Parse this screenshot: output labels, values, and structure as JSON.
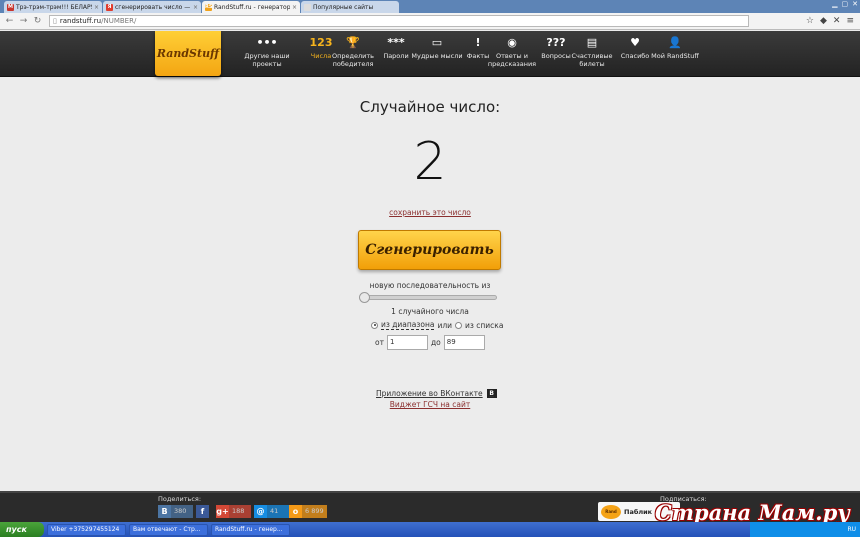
{
  "browser": {
    "tabs": [
      {
        "label": "Трэ-трэм-трэм!!! БЕЛАРУС",
        "fav": "M",
        "fav_color": "#c8342d",
        "active": false
      },
      {
        "label": "сгенерировать число — Ян",
        "fav": "Я",
        "fav_color": "#e03b2c",
        "active": false
      },
      {
        "label": "RandStuff.ru - генератор сл",
        "fav": "RS",
        "fav_color": "#f0a21b",
        "active": true
      },
      {
        "label": "Популярные сайты",
        "fav": "",
        "fav_color": "#dddddd",
        "active": false
      }
    ],
    "url_host": "randstuff.ru",
    "url_path": "/NUMBER/"
  },
  "site": {
    "logo": "RandStuff",
    "nav": [
      {
        "icon": "•••",
        "label": "Другие наши проекты",
        "active": false
      },
      {
        "icon": "123",
        "label": "Числа",
        "active": true
      },
      {
        "icon": "🏆",
        "label": "Определить победителя",
        "active": false
      },
      {
        "icon": "***",
        "label": "Пароли",
        "active": false
      },
      {
        "icon": "▭",
        "label": "Мудрые мысли",
        "active": false
      },
      {
        "icon": "!",
        "label": "Факты",
        "active": false
      },
      {
        "icon": "◉",
        "label": "Ответы и предсказания",
        "active": false
      },
      {
        "icon": "???",
        "label": "Вопросы",
        "active": false
      },
      {
        "icon": "▤",
        "label": "Счастливые билеты",
        "active": false
      },
      {
        "icon": "♥",
        "label": "Спасибо",
        "active": false
      },
      {
        "icon": "👤",
        "label": "Мой RandStuff",
        "active": false
      }
    ]
  },
  "main": {
    "heading": "Случайное число:",
    "number": "2",
    "save_link": "сохранить это число",
    "generate_button": "Сгенерировать",
    "sequence_label": "новую последовательность из",
    "count_label": "1 случайного числа",
    "mode_range": "из диапазона",
    "mode_or": "или",
    "mode_list": "из списка",
    "from_label": "от",
    "from_value": "1",
    "to_label": "до",
    "to_value": "89",
    "vk_app_link": "Приложение во ВКонтакте",
    "vk_badge": "В",
    "widget_link": "Виджет ГСЧ на сайт"
  },
  "footer": {
    "share_label": "Поделиться:",
    "shares": [
      {
        "icon": "В",
        "count": "380",
        "color": "#4c75a3"
      },
      {
        "icon": "f",
        "count": "",
        "color": "#3b5998"
      },
      {
        "icon": "g+",
        "count": "188",
        "color": "#d34836"
      },
      {
        "icon": "@",
        "count": "41",
        "color": "#168de2"
      },
      {
        "icon": "о",
        "count": "6 899",
        "color": "#f59a17"
      }
    ],
    "subscribe_label": "Подписаться:",
    "public_button": "Паблик",
    "watermark": "Страна Мам.ру"
  },
  "taskbar": {
    "start": "пуск",
    "tasks": [
      "Viber +375297455124",
      "Вам отвечают - Стр...",
      "RandStuff.ru - генер..."
    ],
    "lang": "RU"
  }
}
